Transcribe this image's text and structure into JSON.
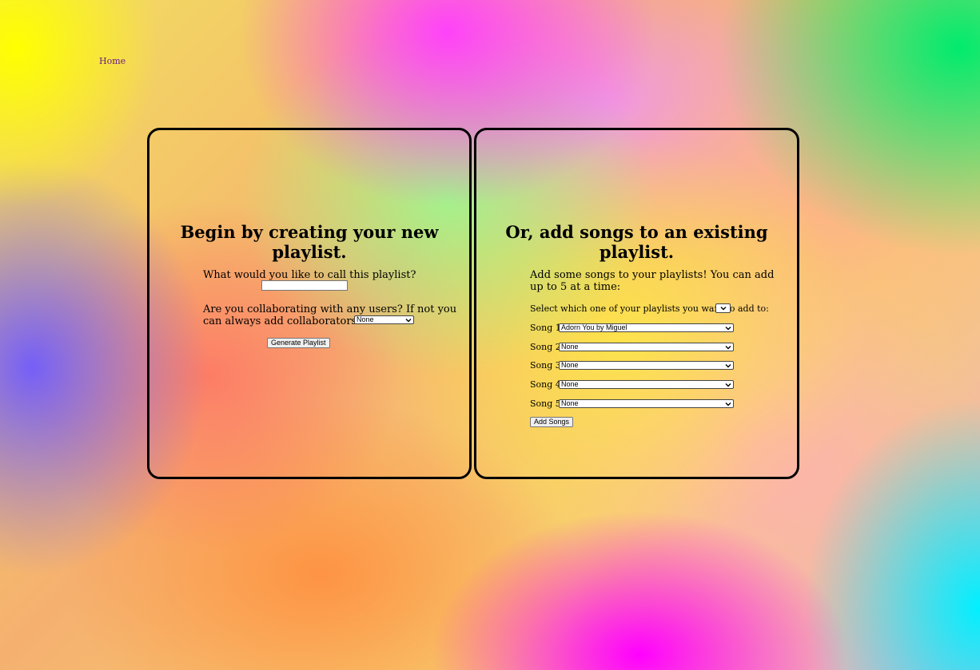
{
  "nav": {
    "home_label": "Home"
  },
  "create": {
    "heading": "Begin by creating your new playlist.",
    "name_question": "What would you like to call this playlist?",
    "name_value": "",
    "collab_question_line1": "Are you collaborating with any users? If not you",
    "collab_question_line2": "can always add collaborators later!",
    "collab_selected": "None",
    "generate_label": "Generate Playlist"
  },
  "add": {
    "heading": "Or, add songs to an existing playlist.",
    "intro_line1": "Add some songs to your playlists! You can add",
    "intro_line2": "up to 5 at a time:",
    "playlist_select_label": "Select which one of your playlists you want to add to:",
    "playlist_selected": "",
    "songs": [
      {
        "label": "Song 1:",
        "selected": "Adorn You by Miguel"
      },
      {
        "label": "Song 2:",
        "selected": "None"
      },
      {
        "label": "Song 3:",
        "selected": "None"
      },
      {
        "label": "Song 4:",
        "selected": "None"
      },
      {
        "label": "Song 5:",
        "selected": "None"
      }
    ],
    "add_label": "Add Songs"
  },
  "icons": {
    "dropdown": "chevron-down-icon"
  }
}
